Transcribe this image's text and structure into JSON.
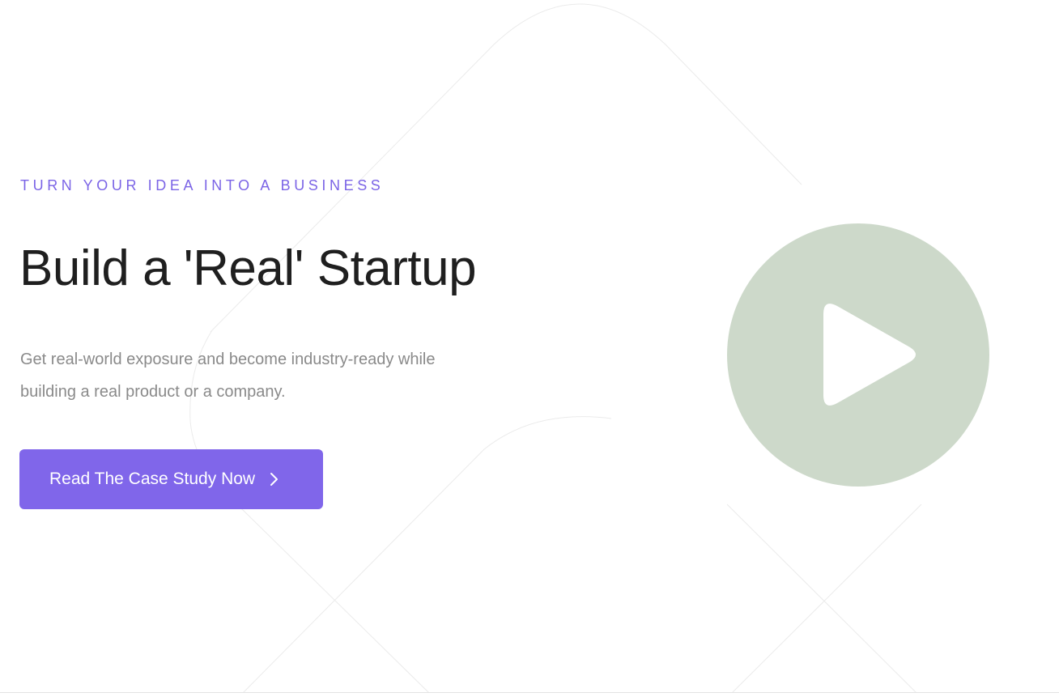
{
  "hero": {
    "eyebrow": "TURN YOUR IDEA INTO A BUSINESS",
    "title": "Build a 'Real' Startup",
    "subtitle_line1": "Get real-world exposure and become industry-ready while",
    "subtitle_line2": "building a real product or a company.",
    "cta_label": "Read The Case Study Now",
    "cta_icon": "chevron-right-icon",
    "video_icon": "play-icon"
  },
  "colors": {
    "accent": "#8066ea",
    "eyebrow_text": "#7b64e6",
    "heading_text": "#1f1f1f",
    "body_text": "#8a8a8a",
    "video_circle": "#cdd9ca",
    "background": "#ffffff"
  }
}
